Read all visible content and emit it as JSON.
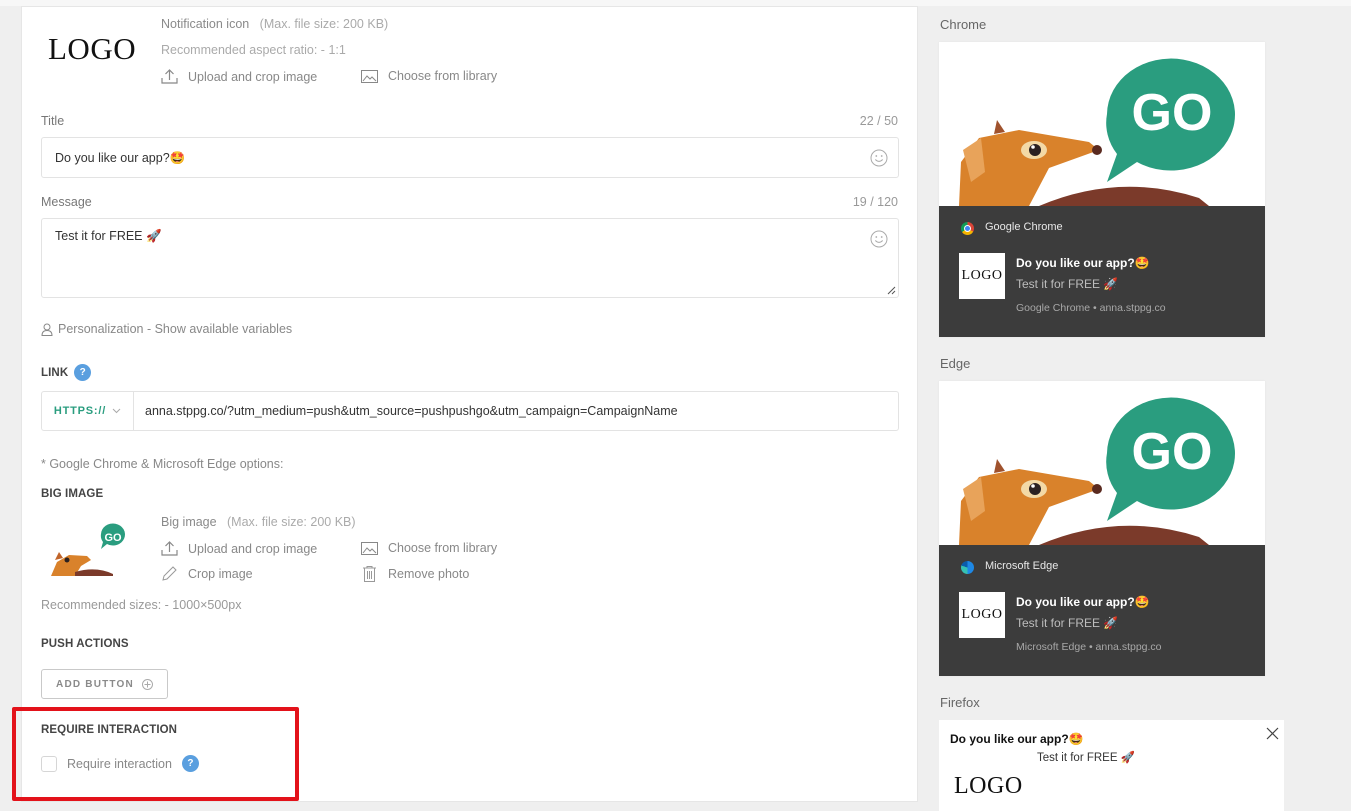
{
  "form": {
    "notification_icon": {
      "logo_text": "LOGO",
      "title": "Notification icon",
      "max_size": "(Max. file size: 200 KB)",
      "aspect": "Recommended aspect ratio: - 1:1",
      "upload_label": "Upload and crop image",
      "library_label": "Choose from library"
    },
    "title_field": {
      "label": "Title",
      "counter": "22 / 50",
      "value": "Do you like our app?🤩"
    },
    "message_field": {
      "label": "Message",
      "counter": "19 / 120",
      "value": "Test it for FREE 🚀"
    },
    "personalization_label": "Personalization - Show available variables",
    "link": {
      "section": "LINK",
      "help": "?",
      "protocol": "HTTPS://",
      "value": "anna.stppg.co/?utm_medium=push&utm_source=pushpushgo&utm_campaign=CampaignName"
    },
    "options_note": "* Google Chrome & Microsoft Edge options:",
    "big_image": {
      "section": "BIG IMAGE",
      "title": "Big image",
      "max_size": "(Max. file size: 200 KB)",
      "upload_label": "Upload and crop image",
      "library_label": "Choose from library",
      "crop_label": "Crop image",
      "remove_label": "Remove photo",
      "recommended": "Recommended sizes: - 1000×500px",
      "go_text": "GO"
    },
    "push_actions": {
      "section": "PUSH ACTIONS",
      "add_button_label": "ADD BUTTON"
    },
    "require_interaction": {
      "section": "REQUIRE INTERACTION",
      "checkbox_label": "Require interaction",
      "checked": false,
      "help": "?"
    }
  },
  "previews": {
    "chrome": {
      "label": "Chrome",
      "browser": "Google Chrome",
      "logo_text": "LOGO",
      "title": "Do you like our app?🤩",
      "message": "Test it for FREE 🚀",
      "footer": "Google Chrome • anna.stppg.co",
      "go_text": "GO"
    },
    "edge": {
      "label": "Edge",
      "browser": "Microsoft Edge",
      "logo_text": "LOGO",
      "title": "Do you like our app?🤩",
      "message": "Test it for FREE 🚀",
      "footer": "Microsoft Edge • anna.stppg.co",
      "go_text": "GO"
    },
    "firefox": {
      "label": "Firefox",
      "title": "Do you like our app?🤩",
      "message": "Test it for FREE 🚀",
      "logo_text": "LOGO"
    }
  },
  "colors": {
    "accent_green": "#2a9d7f",
    "help_blue": "#5a9fdf",
    "highlight_red": "#e3121a",
    "notification_dark": "#3c3c3c"
  }
}
